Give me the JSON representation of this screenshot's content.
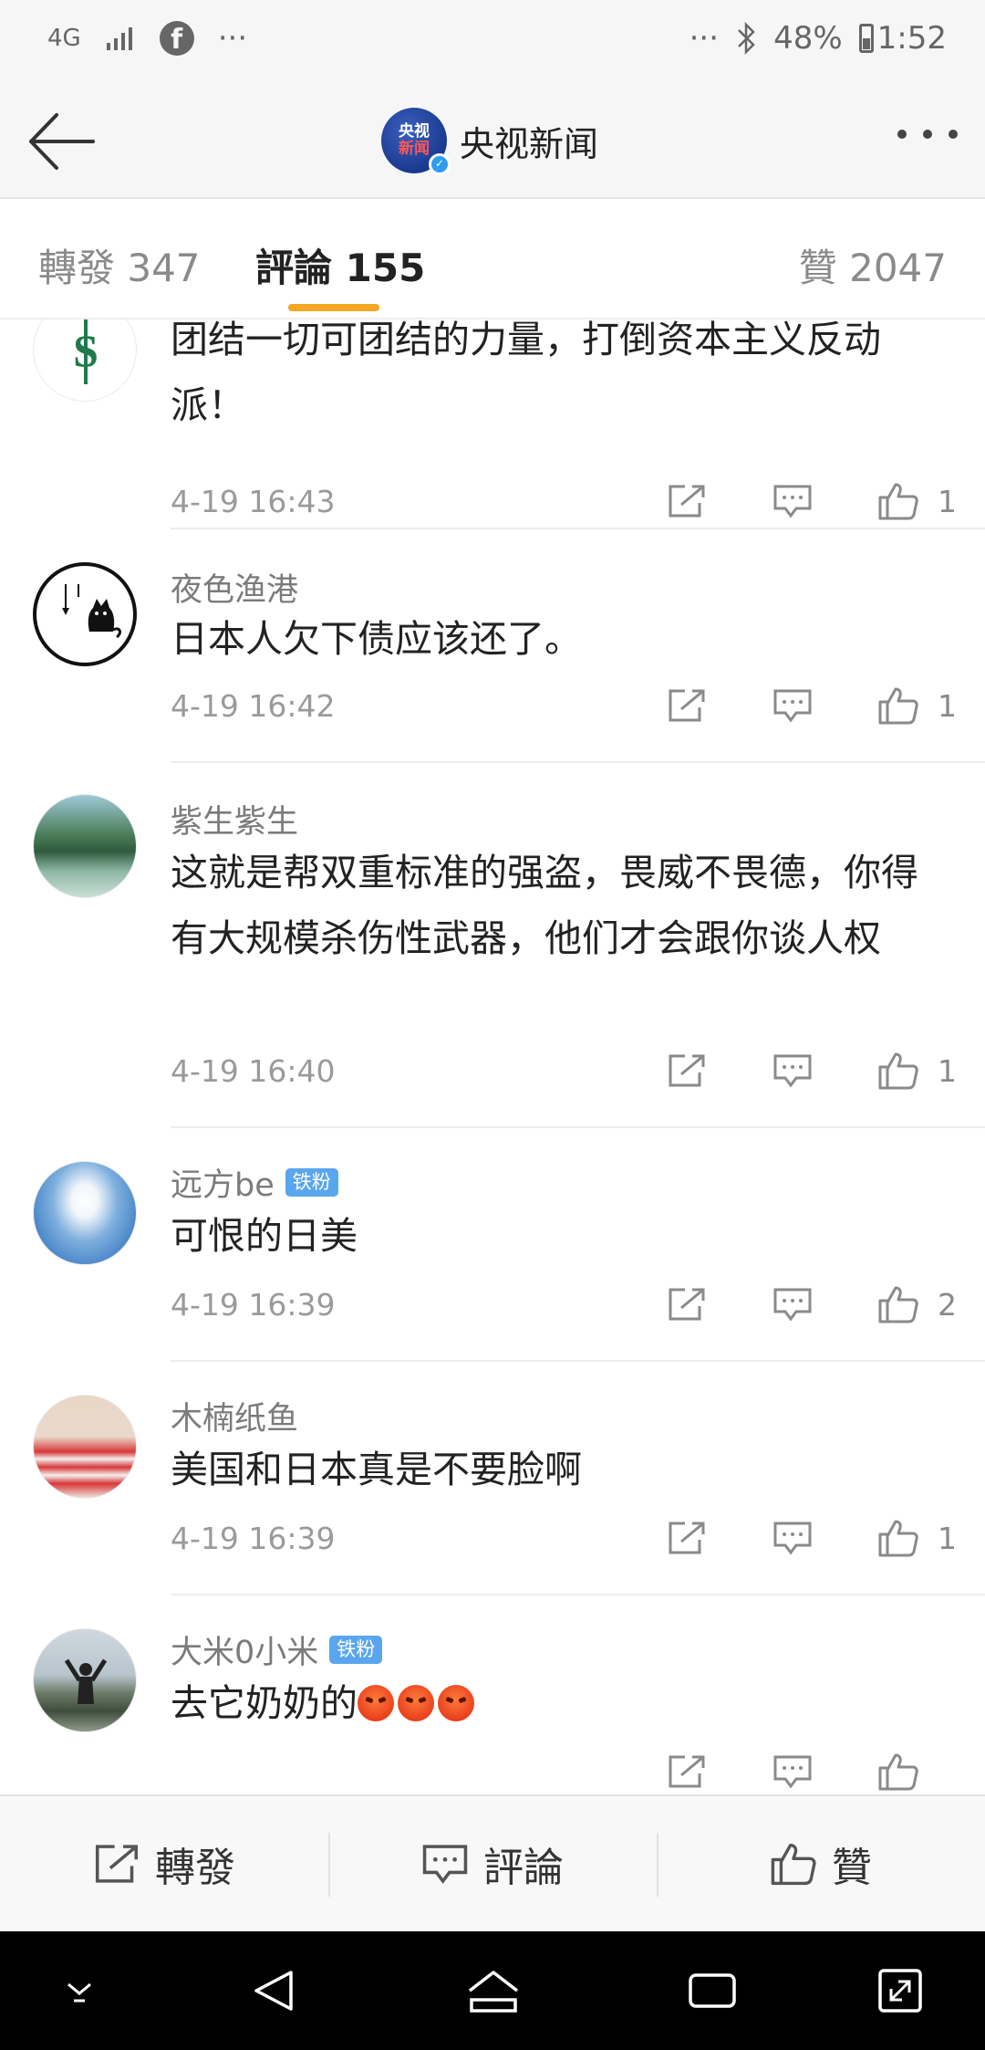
{
  "status_bar": {
    "network": "4G",
    "overflow_left": "···",
    "overflow_right": "···",
    "battery": "48%",
    "time": "1:52"
  },
  "header": {
    "brand_logo_line1": "央视",
    "brand_logo_line2": "新闻",
    "title": "央视新闻"
  },
  "tabs": [
    {
      "label": "轉發 347",
      "active": false
    },
    {
      "label": "評論 155",
      "active": true
    },
    {
      "label": "贊 2047",
      "active": false
    }
  ],
  "comments": [
    {
      "name": "",
      "badge": "",
      "text": "团结一切可团结的力量，打倒资本主义反动派！",
      "time": "4-19 16:43",
      "likes": "1",
      "avatar": "green-s-logo"
    },
    {
      "name": "夜色渔港",
      "badge": "",
      "text": "日本人欠下债应该还了。",
      "time": "4-19 16:42",
      "likes": "1",
      "avatar": "cat-drawing"
    },
    {
      "name": "紫生紫生",
      "badge": "",
      "text": "这就是帮双重标准的强盗，畏威不畏德，你得有大规模杀伤性武器，他们才会跟你谈人权",
      "time": "4-19 16:40",
      "likes": "1",
      "avatar": "lake-landscape"
    },
    {
      "name": "远方be",
      "badge": "铁粉",
      "text": "可恨的日美",
      "time": "4-19 16:39",
      "likes": "2",
      "avatar": "sky-clouds"
    },
    {
      "name": "木楠纸鱼",
      "badge": "",
      "text": "美国和日本真是不要脸啊",
      "time": "4-19 16:39",
      "likes": "1",
      "avatar": "girl-photo"
    },
    {
      "name": "大米0小米",
      "badge": "铁粉",
      "text": "去它奶奶的",
      "time": "",
      "likes": "",
      "avatar": "person-outdoor"
    }
  ],
  "bottom_bar": {
    "repost": "轉發",
    "comment": "評論",
    "like": "贊"
  },
  "colors": {
    "accent_underline": "#f5a623",
    "badge_blue": "#5aa6ee",
    "text_primary": "#222222",
    "text_muted": "#9a9a9a"
  }
}
